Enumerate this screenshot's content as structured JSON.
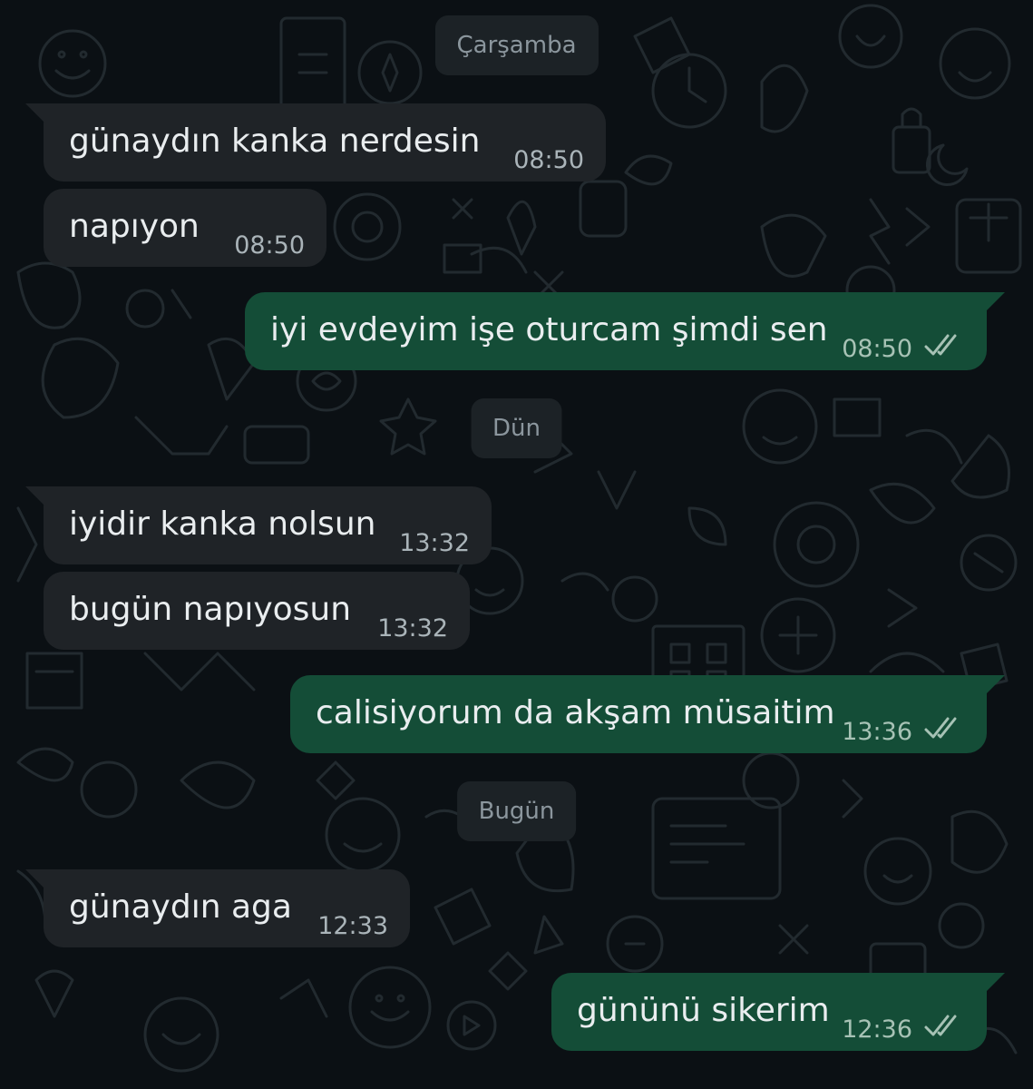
{
  "dates": {
    "d1": "Çarşamba",
    "d2": "Dün",
    "d3": "Bugün"
  },
  "messages": [
    {
      "text": "günaydın kanka nerdesin",
      "time": "08:50"
    },
    {
      "text": "napıyon",
      "time": "08:50"
    },
    {
      "text": "iyi evdeyim işe oturcam şimdi sen",
      "time": "08:50"
    },
    {
      "text": "iyidir kanka nolsun",
      "time": "13:32"
    },
    {
      "text": "bugün napıyosun",
      "time": "13:32"
    },
    {
      "text": "calisiyorum da akşam müsaitim",
      "time": "13:36"
    },
    {
      "text": "günaydın aga",
      "time": "12:33"
    },
    {
      "text": "gününü sikerim",
      "time": "12:36"
    }
  ],
  "icons": {
    "read_receipt": "double-check-icon"
  },
  "colors": {
    "background": "#0b1014",
    "incoming_bubble": "#1f2327",
    "outgoing_bubble": "#144d37",
    "read_receipt": "#a7c2b5"
  }
}
